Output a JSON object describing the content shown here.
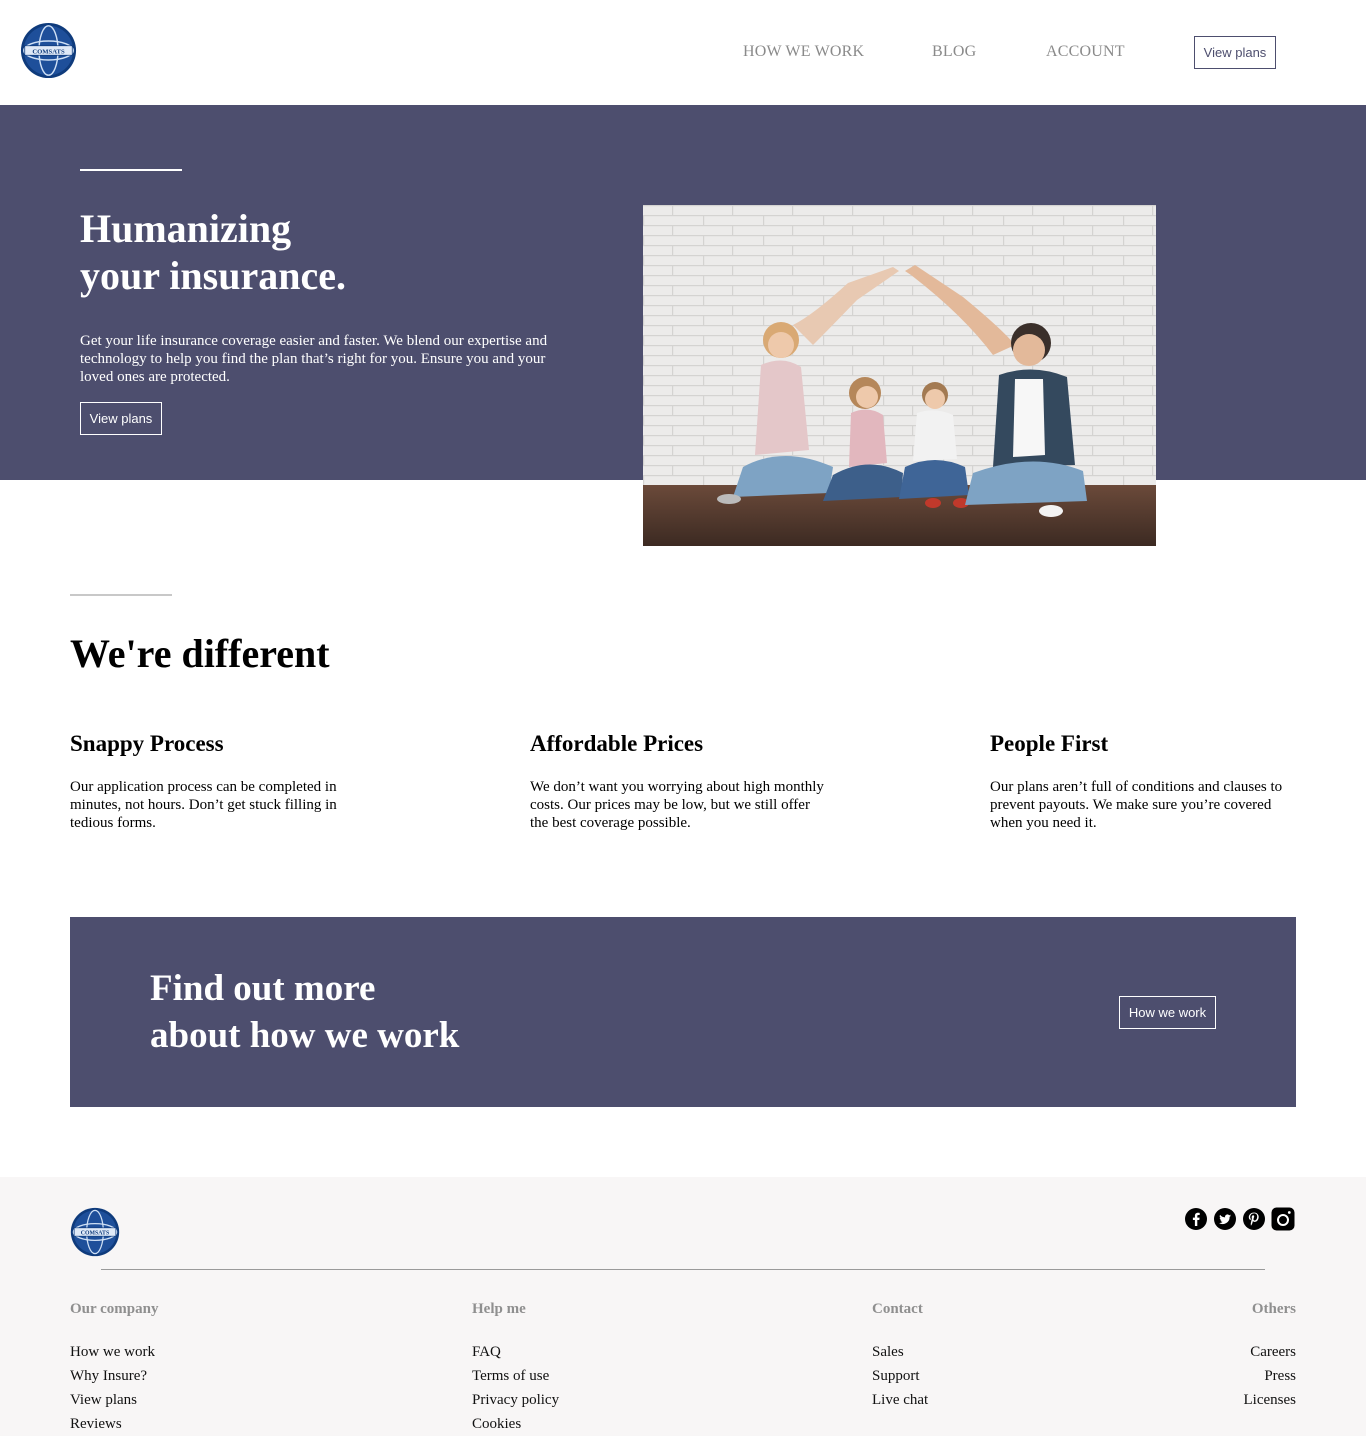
{
  "header": {
    "logo_text": "COMSATS",
    "nav": [
      "HOW WE WORK",
      "BLOG",
      "ACCOUNT"
    ],
    "cta_label": "View plans"
  },
  "hero": {
    "title_line1": "Humanizing",
    "title_line2": "your insurance.",
    "text": "Get your life insurance coverage easier and faster. We blend our expertise and technology to help you find the plan that’s right for you. Ensure you and your loved ones are protected.",
    "button_label": "View plans"
  },
  "different": {
    "title": "We're different",
    "features": [
      {
        "title": "Snappy Process",
        "text": "Our application process can be completed in minutes, not hours. Don’t get stuck filling in tedious forms."
      },
      {
        "title": "Affordable Prices",
        "text": "We don’t want you worrying about high monthly costs. Our prices may be low, but we still offer the best coverage possible."
      },
      {
        "title": "People First",
        "text": "Our plans aren’t full of conditions and clauses to prevent payouts. We make sure you’re covered when you need it."
      }
    ]
  },
  "cta": {
    "title_line1": "Find out more",
    "title_line2": "about how we work",
    "button_label": "How we work"
  },
  "footer": {
    "social_icons": [
      "facebook-icon",
      "twitter-icon",
      "pinterest-icon",
      "instagram-icon"
    ],
    "columns": [
      {
        "heading": "Our company",
        "links": [
          "How we work",
          "Why Insure?",
          "View plans",
          "Reviews"
        ]
      },
      {
        "heading": "Help me",
        "links": [
          "FAQ",
          "Terms of use",
          "Privacy policy",
          "Cookies"
        ]
      },
      {
        "heading": "Contact",
        "links": [
          "Sales",
          "Support",
          "Live chat"
        ]
      },
      {
        "heading": "Others",
        "links": [
          "Careers",
          "Press",
          "Licenses"
        ]
      }
    ]
  },
  "colors": {
    "brand": "#4d4e6e",
    "footer_bg": "#f8f6f6",
    "muted": "#8a8a8a"
  }
}
